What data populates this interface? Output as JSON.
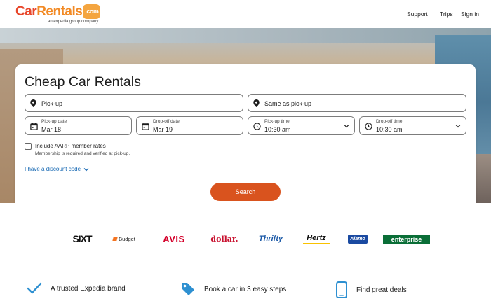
{
  "header": {
    "logo_car": "Car",
    "logo_rentals": "Rentals",
    "logo_com": ".com",
    "logo_sub": "an expedia group company",
    "nav": [
      "Support",
      "Trips",
      "Sign in"
    ]
  },
  "search": {
    "title": "Cheap Car Rentals",
    "pickup_placeholder": "Pick-up",
    "dropoff_placeholder": "Same as pick-up",
    "pickup_date": {
      "label": "Pick-up date",
      "value": "Mar 18"
    },
    "dropoff_date": {
      "label": "Drop-off date",
      "value": "Mar 19"
    },
    "pickup_time": {
      "label": "Pick-up time",
      "value": "10:30 am"
    },
    "dropoff_time": {
      "label": "Drop-off time",
      "value": "10:30 am"
    },
    "aarp_label": "Include AARP member rates",
    "aarp_note": "Membership is required and verified at pick-up.",
    "aarp_checked": false,
    "discount_link": "I have a discount code",
    "search_button": "Search"
  },
  "brands": [
    "SIXT",
    "Budget",
    "AVIS",
    "dollar.",
    "Thrifty",
    "Hertz",
    "Alamo",
    "enterprise"
  ],
  "features": [
    {
      "icon": "checkmark-icon",
      "text": "A trusted Expedia brand"
    },
    {
      "icon": "tag-icon",
      "text": "Book a car in 3 easy steps"
    },
    {
      "icon": "mobile-phone-icon",
      "text": "Find great deals"
    }
  ],
  "colors": {
    "accent": "#d9531e",
    "link": "#1668b3",
    "icon_blue": "#2e90d1"
  }
}
